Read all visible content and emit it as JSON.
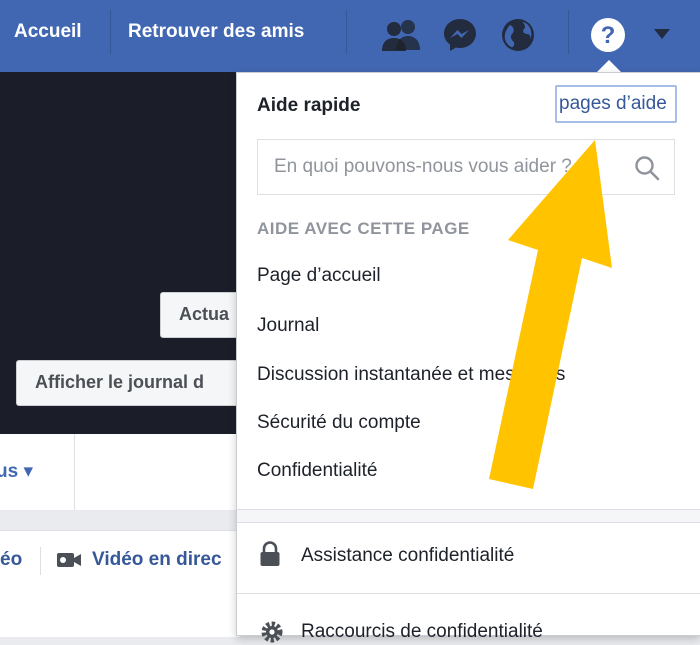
{
  "topbar": {
    "home_label": "Accueil",
    "find_friends_label": "Retrouver des amis",
    "icons": [
      "friends-icon",
      "messenger-icon",
      "globe-icon",
      "help-icon",
      "caret-down-icon"
    ]
  },
  "cover": {
    "update_button_label": "Actua",
    "view_journal_button_label": "Afficher le journal d"
  },
  "tabs": {
    "more_label": "us ▾"
  },
  "composer": {
    "video_partial_label": "éo",
    "live_video_label": "Vidéo en direc"
  },
  "help_menu": {
    "title": "Aide rapide",
    "help_pages_link": "pages d’aide",
    "search_placeholder": "En quoi pouvons-nous vous aider ?",
    "section_title": "AIDE AVEC CETTE PAGE",
    "items": [
      "Page d’accueil",
      "Journal",
      "Discussion instantanée et messages",
      "Sécurité du compte",
      "Confidentialité"
    ],
    "privacy_assistance_label": "Assistance confidentialité",
    "privacy_shortcuts_label": "Raccourcis de confidentialité"
  },
  "colors": {
    "topbar": "#4267b2",
    "link": "#365899",
    "annotation_arrow": "#ffc300",
    "cover": "#1b1e29"
  }
}
